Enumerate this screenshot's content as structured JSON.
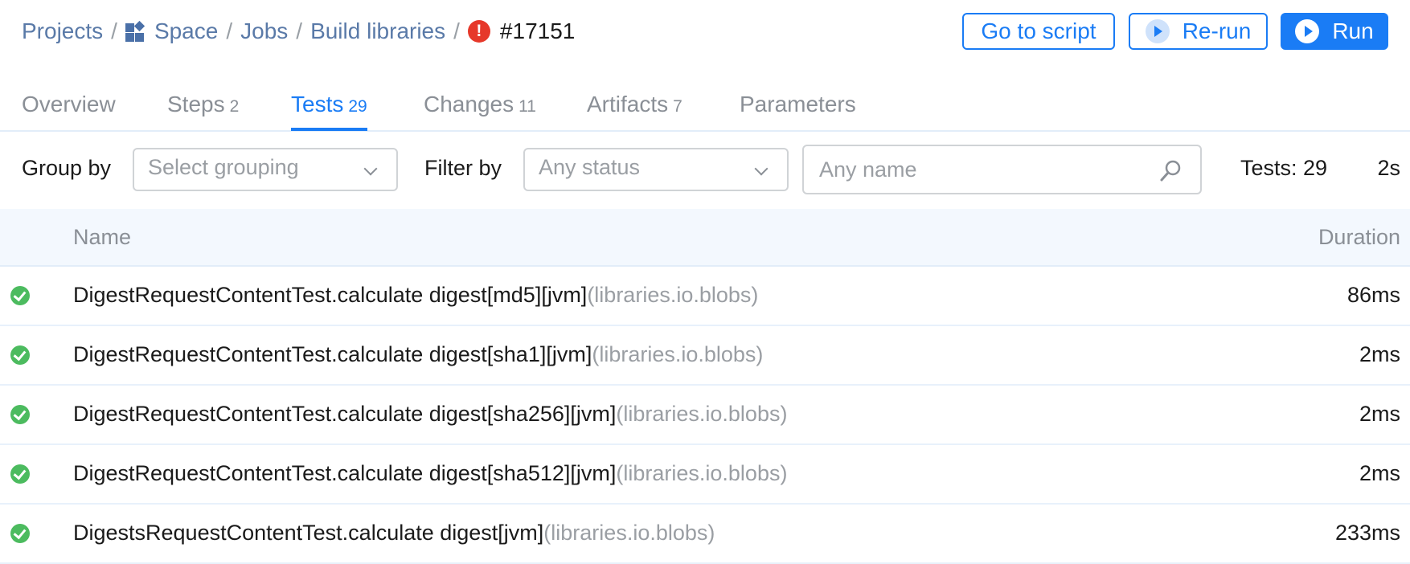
{
  "breadcrumb": {
    "items": [
      "Projects",
      "Space",
      "Jobs",
      "Build libraries"
    ],
    "separator": "/",
    "run_status_icon": "error-icon",
    "run_id": "#17151"
  },
  "actions": {
    "go_to_script": "Go to script",
    "rerun": "Re-run",
    "run": "Run"
  },
  "tabs": [
    {
      "label": "Overview",
      "count": ""
    },
    {
      "label": "Steps",
      "count": "2"
    },
    {
      "label": "Tests",
      "count": "29",
      "active": true
    },
    {
      "label": "Changes",
      "count": "11"
    },
    {
      "label": "Artifacts",
      "count": "7"
    },
    {
      "label": "Parameters",
      "count": ""
    }
  ],
  "filters": {
    "group_by_label": "Group by",
    "group_by_placeholder": "Select grouping",
    "filter_by_label": "Filter by",
    "status_placeholder": "Any status",
    "name_placeholder": "Any name",
    "tests_count": "Tests: 29",
    "total_duration": "2s"
  },
  "table": {
    "columns": {
      "name": "Name",
      "duration": "Duration"
    },
    "rows": [
      {
        "status": "passed",
        "name": "DigestRequestContentTest.calculate digest[md5][jvm]",
        "package": "(libraries.io.blobs)",
        "duration": "86ms"
      },
      {
        "status": "passed",
        "name": "DigestRequestContentTest.calculate digest[sha1][jvm]",
        "package": "(libraries.io.blobs)",
        "duration": "2ms"
      },
      {
        "status": "passed",
        "name": "DigestRequestContentTest.calculate digest[sha256][jvm]",
        "package": "(libraries.io.blobs)",
        "duration": "2ms"
      },
      {
        "status": "passed",
        "name": "DigestRequestContentTest.calculate digest[sha512][jvm]",
        "package": "(libraries.io.blobs)",
        "duration": "2ms"
      },
      {
        "status": "passed",
        "name": "DigestsRequestContentTest.calculate digest[jvm]",
        "package": "(libraries.io.blobs)",
        "duration": "233ms"
      }
    ]
  },
  "colors": {
    "accent": "#1a7cf5",
    "link": "#5a7aa8",
    "error": "#e6382a",
    "success": "#4cbb5f",
    "muted": "#9a9ea3"
  }
}
